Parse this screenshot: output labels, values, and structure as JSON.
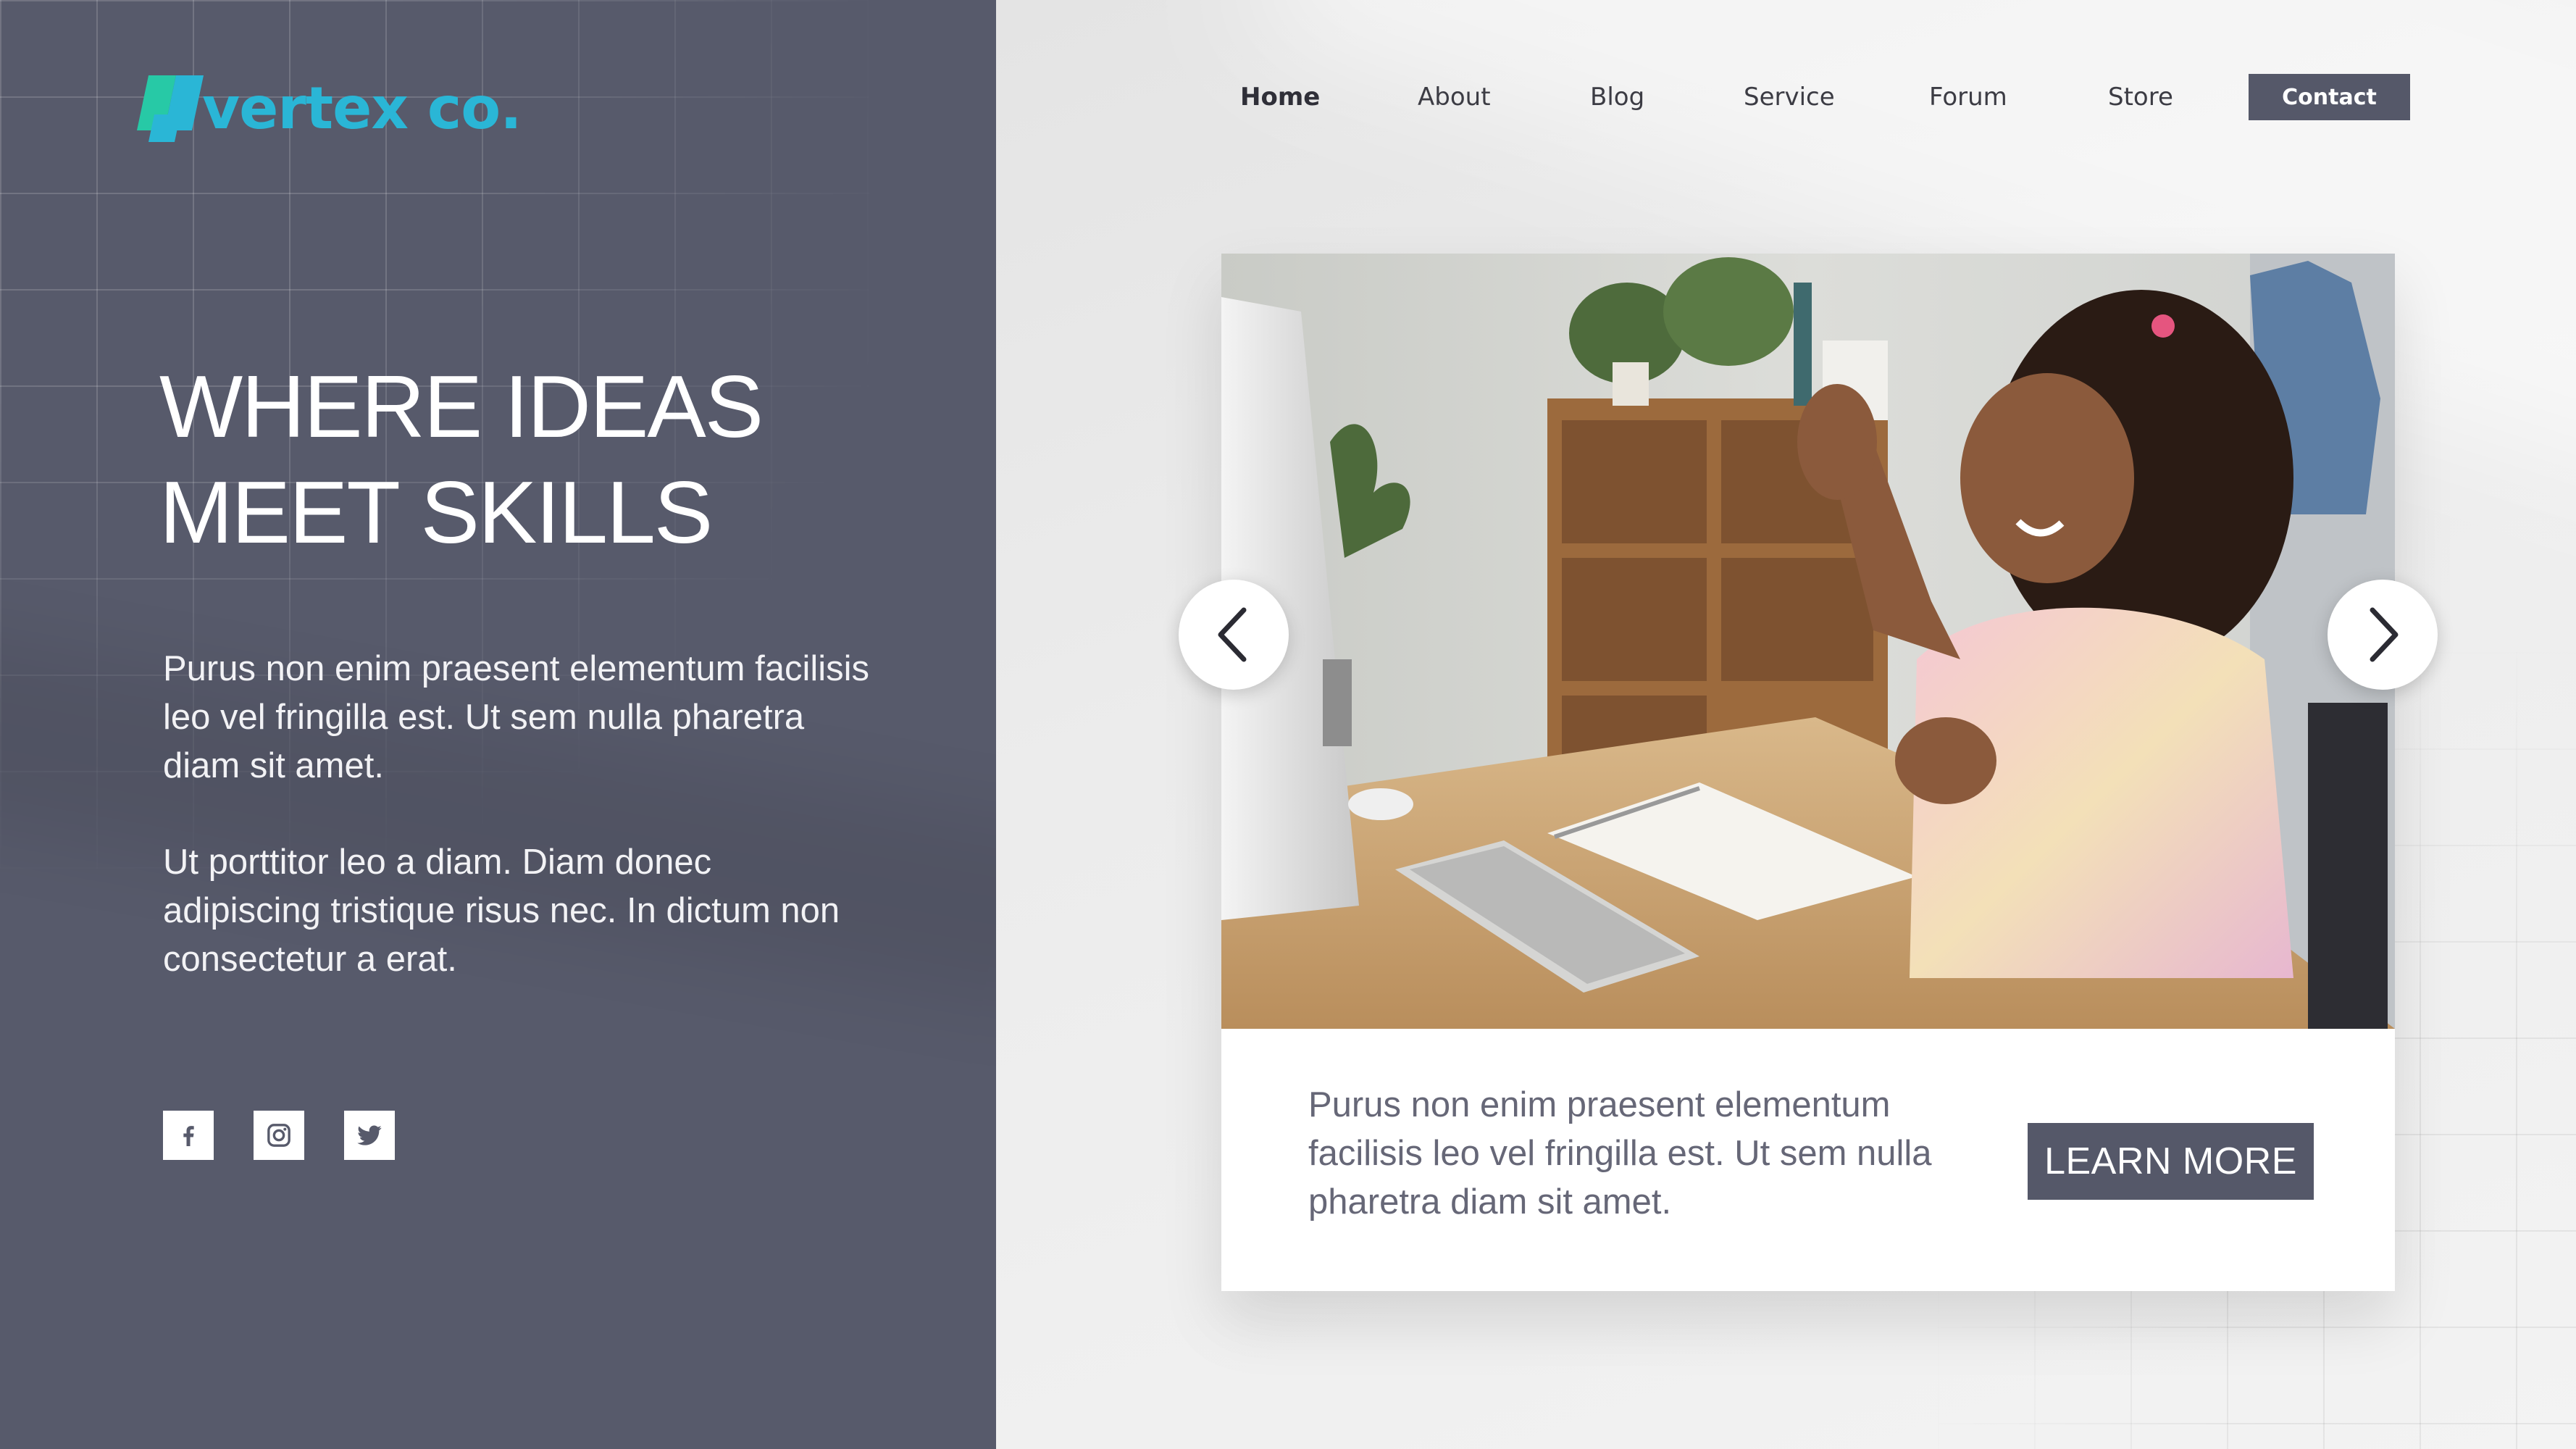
{
  "brand": {
    "name": "vertex co.",
    "logo_icon": "stacked-squares-logo-icon",
    "colors": {
      "logo_teal": "#2ab6d6",
      "logo_green": "#27c9a6",
      "panel": "#575a6b",
      "button": "#555869"
    }
  },
  "nav": {
    "items": [
      {
        "label": "Home",
        "active": true
      },
      {
        "label": "About"
      },
      {
        "label": "Blog"
      },
      {
        "label": "Service"
      },
      {
        "label": "Forum"
      },
      {
        "label": "Store"
      }
    ],
    "contact_label": "Contact"
  },
  "hero": {
    "title": "WHERE IDEAS\nMEET SKILLS",
    "paragraph1": "Purus non enim praesent elementum facilisis leo vel fringilla est. Ut sem nulla pharetra diam sit amet.",
    "paragraph2": "Ut porttitor leo a diam. Diam donec adipiscing tristique risus nec. In dictum non consectetur a erat."
  },
  "socials": [
    {
      "icon": "facebook-icon"
    },
    {
      "icon": "instagram-icon"
    },
    {
      "icon": "twitter-icon"
    }
  ],
  "carousel": {
    "prev_icon": "chevron-left-icon",
    "next_icon": "chevron-right-icon",
    "card_text": "Purus non enim praesent elementum facilisis leo vel fringilla est. Ut sem nulla pharetra diam sit amet.",
    "button_label": "LEARN MORE",
    "photo": "girl-waving-at-computer-photo"
  }
}
